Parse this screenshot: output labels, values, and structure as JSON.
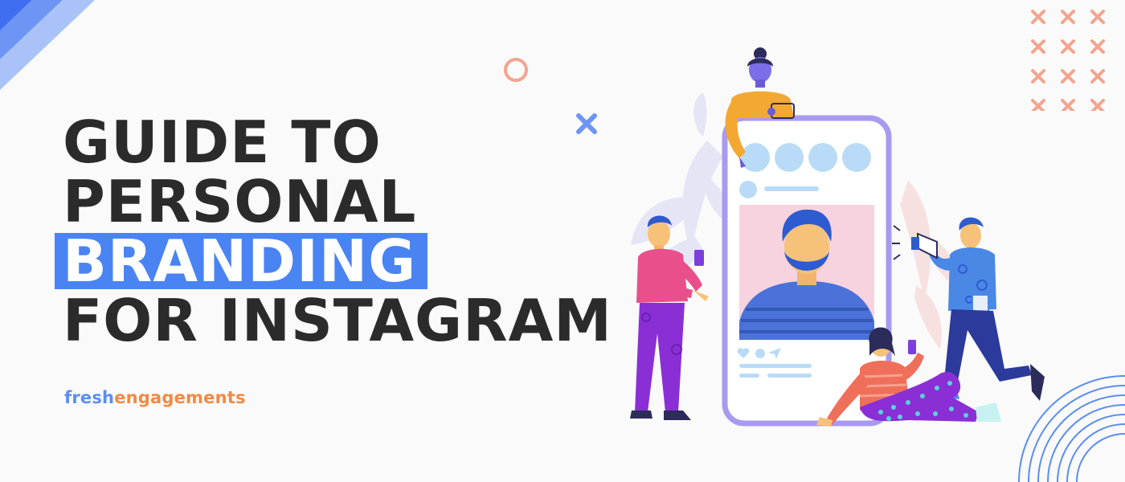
{
  "headline": {
    "line1": "GUIDE TO",
    "line2": "PERSONAL",
    "line3": "BRANDING",
    "line4": "FOR INSTAGRAM"
  },
  "brand": {
    "part1": "fresh",
    "part2": "engagements"
  },
  "colors": {
    "accent_blue": "#4a84f3",
    "brand_orange": "#f28a45",
    "heading_dark": "#2b2b2b",
    "decor_coral": "#f4a48e"
  },
  "icons": [
    "corner-stripes-decoration",
    "x-pattern-decoration",
    "ring-decoration",
    "x-mark-icon",
    "concentric-arcs-decoration",
    "heart-icon",
    "comment-icon",
    "share-icon",
    "megaphone-icon"
  ]
}
